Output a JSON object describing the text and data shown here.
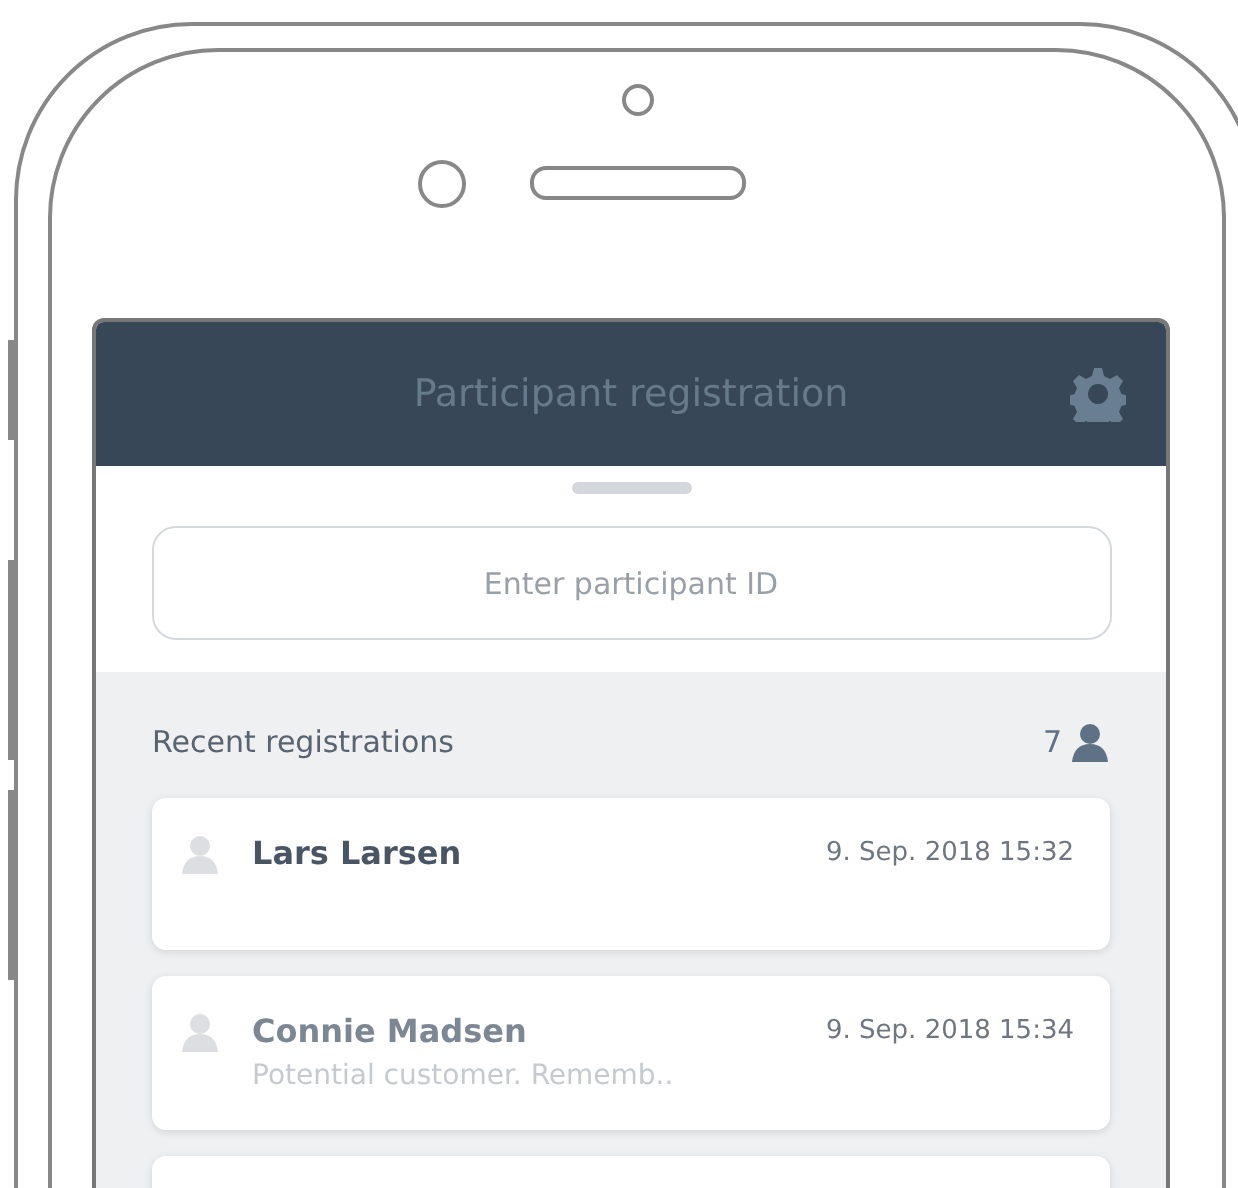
{
  "header": {
    "title": "Participant registration"
  },
  "search": {
    "placeholder": "Enter participant ID"
  },
  "recent": {
    "label": "Recent registrations",
    "count": "7"
  },
  "registrations": [
    {
      "name": "Lars Larsen",
      "time": "9. Sep. 2018 15:32",
      "dimmed": false
    },
    {
      "name": "Connie Madsen",
      "time": "9. Sep. 2018 15:34",
      "note": "Potential customer. Rememb..",
      "dimmed": true
    }
  ]
}
